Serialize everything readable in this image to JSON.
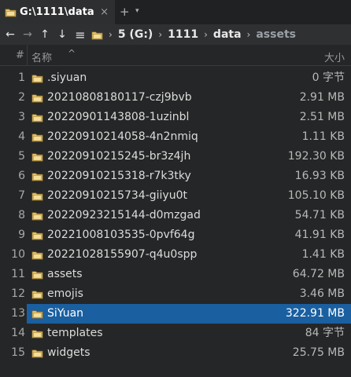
{
  "tab": {
    "title": "G:\\1111\\data",
    "close": "×",
    "new_tab": "+",
    "menu": "▾"
  },
  "toolbar": {
    "back": "←",
    "forward": "→",
    "up": "↑",
    "down": "↓",
    "menu": "≡",
    "breadcrumb": [
      "5 (G:)",
      "1111",
      "data",
      "assets"
    ],
    "separator": "›"
  },
  "header": {
    "index": "#",
    "name": "名称",
    "sort": "^",
    "size": "大小"
  },
  "files": [
    {
      "index": "1",
      "name": ".siyuan",
      "size": "0 字节"
    },
    {
      "index": "2",
      "name": "20210808180117-czj9bvb",
      "size": "2.91 MB"
    },
    {
      "index": "3",
      "name": "20220901143808-1uzinbl",
      "size": "2.51 MB"
    },
    {
      "index": "4",
      "name": "20220910214058-4n2nmiq",
      "size": "1.11 KB"
    },
    {
      "index": "5",
      "name": "20220910215245-br3z4jh",
      "size": "192.30 KB"
    },
    {
      "index": "6",
      "name": "20220910215318-r7k3tky",
      "size": "16.93 KB"
    },
    {
      "index": "7",
      "name": "20220910215734-giiyu0t",
      "size": "105.10 KB"
    },
    {
      "index": "8",
      "name": "20220923215144-d0mzgad",
      "size": "54.71 KB"
    },
    {
      "index": "9",
      "name": "20221008103535-0pvf64g",
      "size": "41.91 KB"
    },
    {
      "index": "10",
      "name": "20221028155907-q4u0spp",
      "size": "1.41 KB"
    },
    {
      "index": "11",
      "name": "assets",
      "size": "64.72 MB"
    },
    {
      "index": "12",
      "name": "emojis",
      "size": "3.46 MB"
    },
    {
      "index": "13",
      "name": "SiYuan",
      "size": "322.91 MB",
      "selected": true
    },
    {
      "index": "14",
      "name": "templates",
      "size": "84 字节"
    },
    {
      "index": "15",
      "name": "widgets",
      "size": "25.75 MB"
    }
  ],
  "colors": {
    "background": "#252627",
    "selection": "#1a5fa0",
    "folder": "#e8c46a"
  }
}
